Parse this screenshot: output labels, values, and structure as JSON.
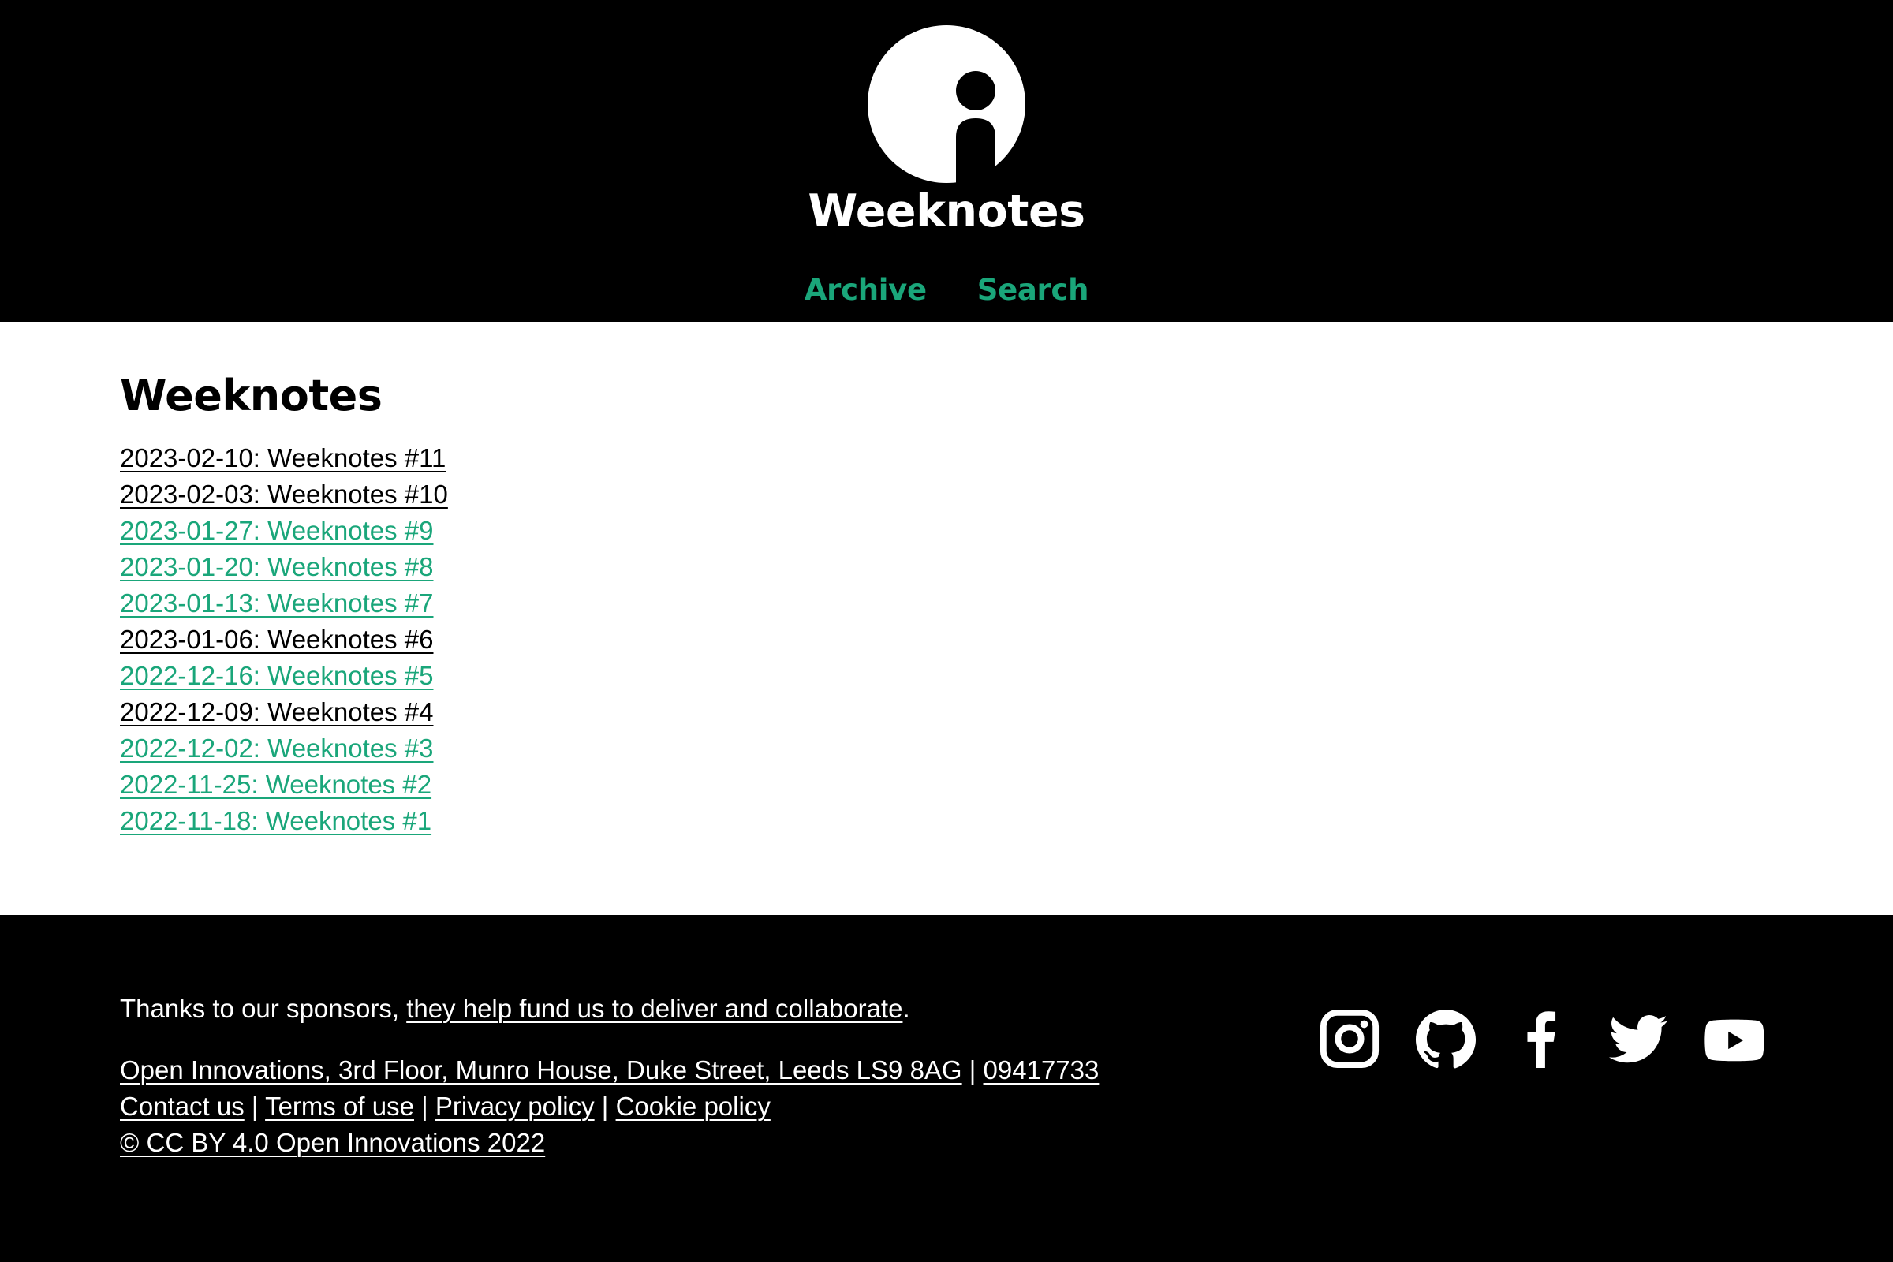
{
  "theme": {
    "accent": "#1aa67a",
    "header_bg": "#000000",
    "main_bg": "#ffffff",
    "footer_bg": "#000000"
  },
  "header": {
    "logo_icon": "info-person-logo",
    "site_title": "Weeknotes",
    "nav": [
      {
        "label": "Archive"
      },
      {
        "label": "Search"
      }
    ]
  },
  "main": {
    "heading": "Weeknotes",
    "posts": [
      {
        "label": "2023-02-10: Weeknotes #11",
        "visited": true
      },
      {
        "label": "2023-02-03: Weeknotes #10",
        "visited": true
      },
      {
        "label": "2023-01-27: Weeknotes #9",
        "visited": false
      },
      {
        "label": "2023-01-20: Weeknotes #8",
        "visited": false
      },
      {
        "label": "2023-01-13: Weeknotes #7",
        "visited": false
      },
      {
        "label": "2023-01-06: Weeknotes #6",
        "visited": true
      },
      {
        "label": "2022-12-16: Weeknotes #5",
        "visited": false
      },
      {
        "label": "2022-12-09: Weeknotes #4",
        "visited": true
      },
      {
        "label": "2022-12-02: Weeknotes #3",
        "visited": false
      },
      {
        "label": "2022-11-25: Weeknotes #2",
        "visited": false
      },
      {
        "label": "2022-11-18: Weeknotes #1",
        "visited": false
      }
    ]
  },
  "footer": {
    "sponsor_prefix": "Thanks to our sponsors, ",
    "sponsor_link": "they help fund us to deliver and collaborate",
    "sponsor_suffix": ".",
    "address_link": "Open Innovations, 3rd Floor, Munro House, Duke Street, Leeds LS9 8AG",
    "separator": " | ",
    "company_number": "09417733",
    "contact": "Contact us",
    "terms": "Terms of use",
    "privacy": "Privacy policy",
    "cookie": "Cookie policy",
    "copyright": "© CC BY 4.0 Open Innovations 2022",
    "social_icons": [
      "instagram-icon",
      "github-icon",
      "facebook-icon",
      "twitter-icon",
      "youtube-icon"
    ]
  }
}
